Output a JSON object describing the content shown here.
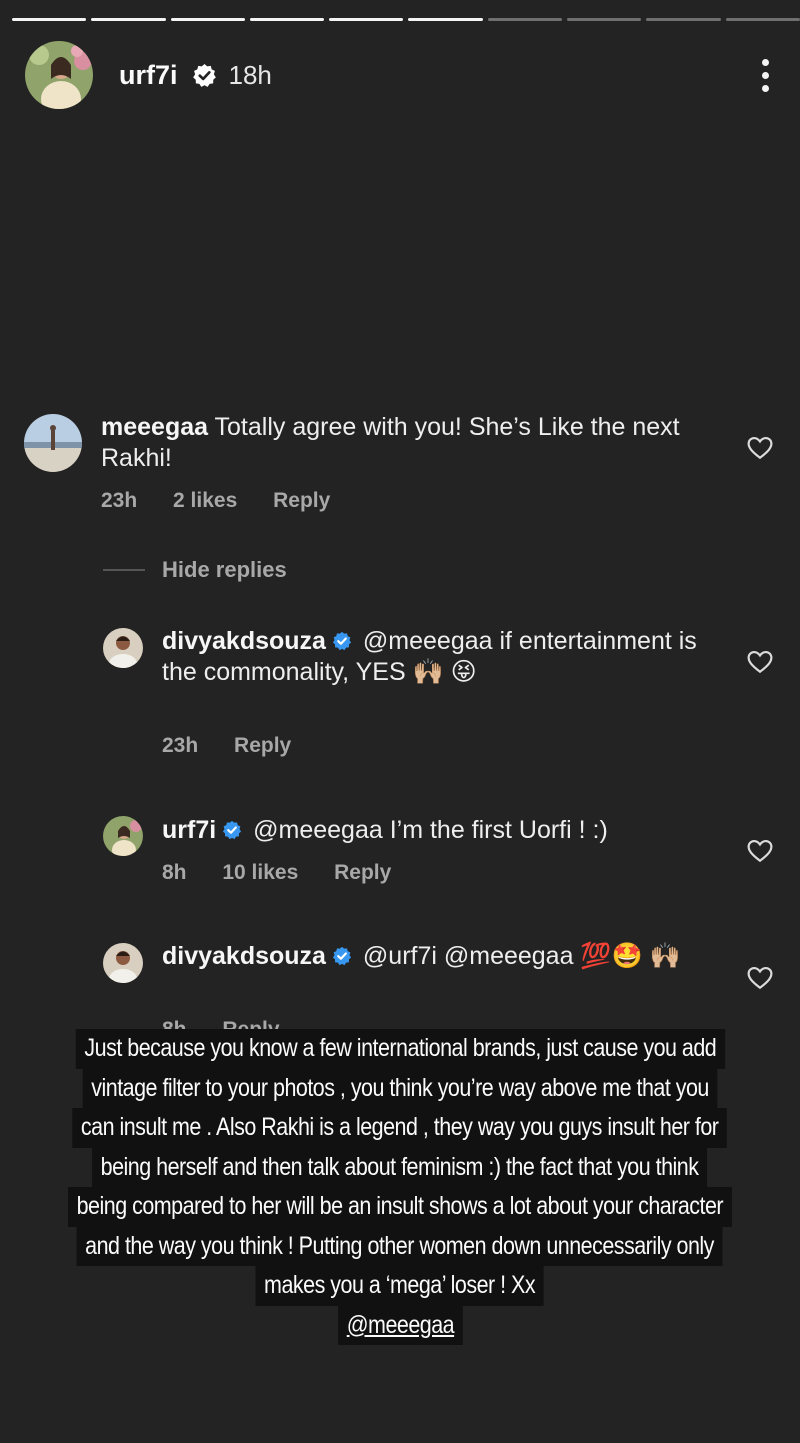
{
  "story": {
    "progress": {
      "total_segments": 10,
      "completed_segments": 6
    },
    "header": {
      "username": "urf7i",
      "verified": true,
      "time": "18h",
      "more_icon": "more-vertical-icon"
    }
  },
  "comments": {
    "top": {
      "username": "meeegaa",
      "text": "Totally agree with you! She’s Like the next Rakhi!",
      "time": "23h",
      "likes": "2 likes",
      "reply": "Reply"
    },
    "hide_replies": "Hide replies",
    "replies": [
      {
        "username": "divyakdsouza",
        "verified": true,
        "text": "@meeegaa if entertainment is the commonality, YES 🙌🏼 😝",
        "time": "23h",
        "reply": "Reply"
      },
      {
        "username": "urf7i",
        "verified": true,
        "text": "@meeegaa I’m the first Uorfi ! :)",
        "time": "8h",
        "likes": "10 likes",
        "reply": "Reply"
      },
      {
        "username": "divyakdsouza",
        "verified": true,
        "text": "@urf7i @meeegaa 💯🤩 🙌🏼",
        "time": "8h",
        "reply": "Reply"
      }
    ]
  },
  "overlay": {
    "lines": [
      "Just because you know a few international brands, just cause you add",
      "vintage filter to your photos , you think you’re way above me that you",
      "can insult me . Also Rakhi is a legend , they way you guys insult her for",
      "being herself and then talk about feminism :)  the fact that you think",
      "being compared to her will be an insult shows a lot about your character",
      "and the way you think ! Putting other women down unnecessarily only",
      "makes you a ‘mega’ loser ! Xx"
    ],
    "mention": "@meeegaa"
  },
  "colors": {
    "background": "#232323",
    "text": "#eeeeee",
    "muted": "#a8a8a8",
    "verified_blue": "#3897f0",
    "overlay_bg": "#111111"
  }
}
